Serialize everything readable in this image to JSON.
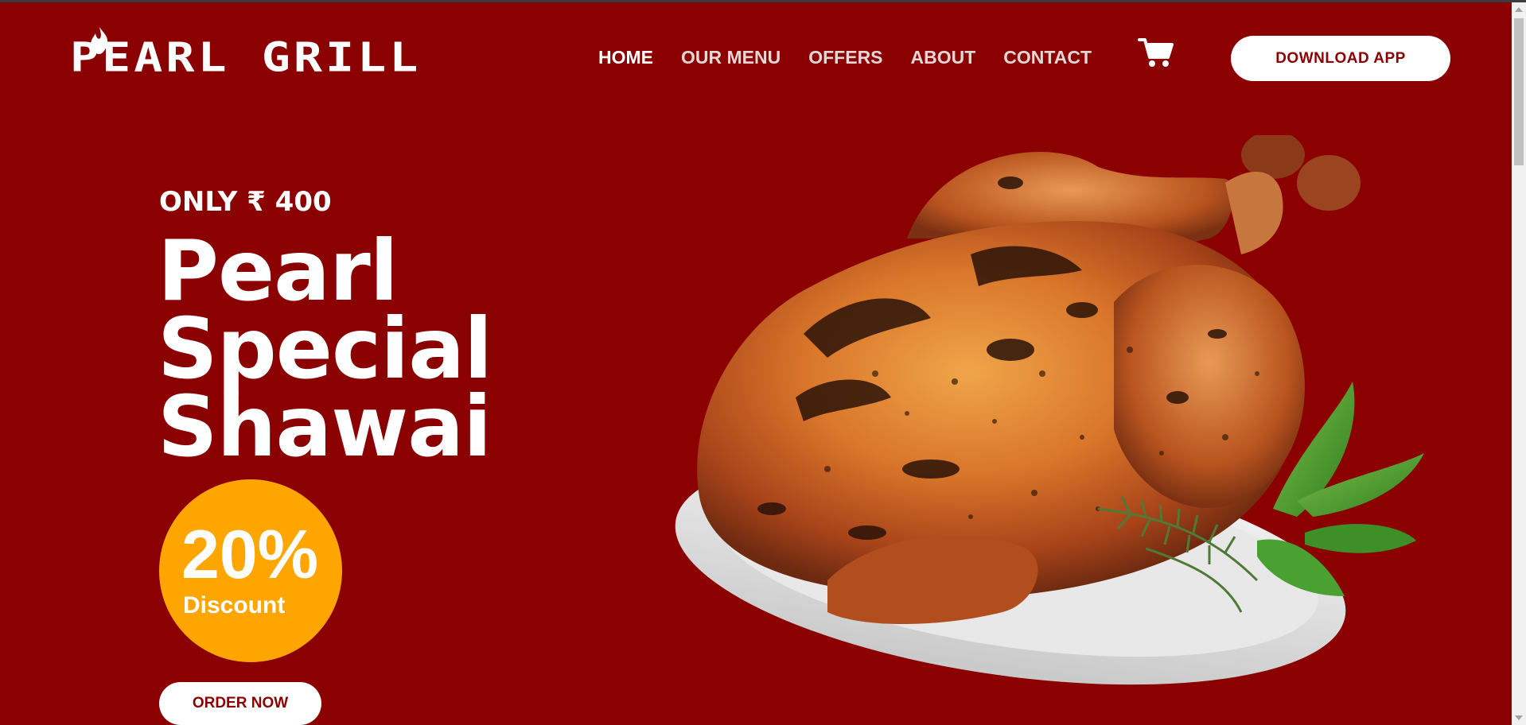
{
  "brand": {
    "name": "PEARL GRILL",
    "primary_color": "#8b0000",
    "accent_color": "#ffa500"
  },
  "nav": {
    "items": [
      {
        "label": "HOME",
        "active": true
      },
      {
        "label": "OUR MENU",
        "active": false
      },
      {
        "label": "OFFERS",
        "active": false
      },
      {
        "label": "ABOUT",
        "active": false
      },
      {
        "label": "CONTACT",
        "active": false
      }
    ],
    "cart_icon": "cart-icon",
    "download_label": "DOWNLOAD APP"
  },
  "hero": {
    "price_text": "ONLY ₹ 400",
    "title_lines": [
      "Pearl",
      "Special",
      "Shawai"
    ],
    "discount_value": "20%",
    "discount_label": "Discount",
    "order_label": "ORDER NOW",
    "image": "roasted-chicken-platter"
  }
}
